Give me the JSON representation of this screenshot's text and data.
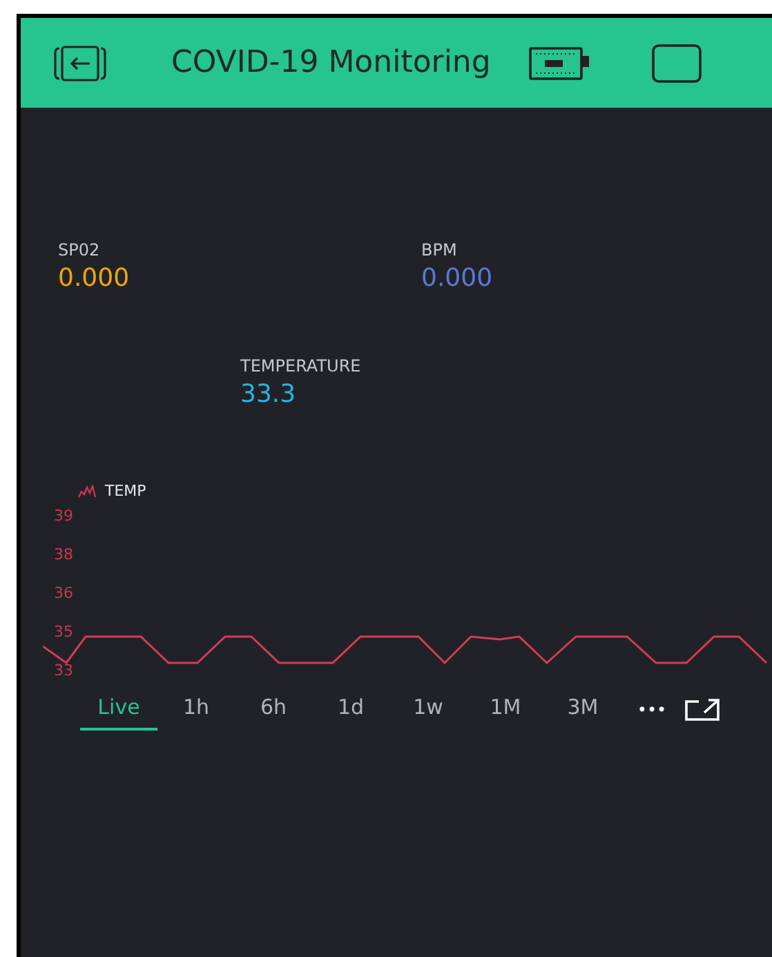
{
  "header": {
    "title": "COVID-19 Monitoring"
  },
  "displays": [
    {
      "label": "SP02",
      "value": "0.000",
      "color": "#f0a30a"
    },
    {
      "label": "BPM",
      "value": "0.000",
      "color": "#5a78d4"
    },
    {
      "label": "TEMPERATURE",
      "value": "33.3",
      "color": "#22b8e8"
    }
  ],
  "chart": {
    "legend": "TEMP",
    "y_axis_labels": [
      "39",
      "38",
      "36",
      "35",
      "33"
    ]
  },
  "time_ranges": [
    {
      "label": "Live",
      "selected": true
    },
    {
      "label": "1h",
      "selected": false
    },
    {
      "label": "6h",
      "selected": false
    },
    {
      "label": "1d",
      "selected": false
    },
    {
      "label": "1w",
      "selected": false
    },
    {
      "label": "1M",
      "selected": false
    },
    {
      "label": "3M",
      "selected": false
    }
  ],
  "more_menu": "•••"
}
